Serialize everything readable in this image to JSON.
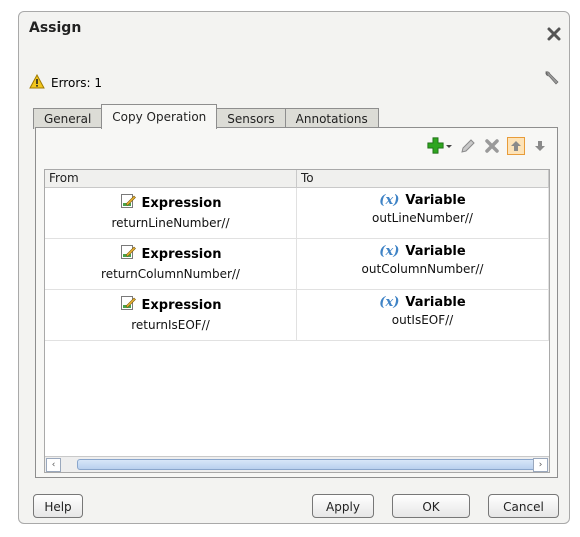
{
  "dialog": {
    "title": "Assign",
    "errors_label": "Errors: 1"
  },
  "tabs": [
    {
      "label": "General",
      "active": false
    },
    {
      "label": "Copy Operation",
      "active": true
    },
    {
      "label": "Sensors",
      "active": false
    },
    {
      "label": "Annotations",
      "active": false
    }
  ],
  "table": {
    "columns": [
      "From",
      "To"
    ],
    "rows": [
      {
        "from_kind": "Expression",
        "from_value": "returnLineNumber//",
        "to_kind": "Variable",
        "to_value": "outLineNumber//"
      },
      {
        "from_kind": "Expression",
        "from_value": "returnColumnNumber//",
        "to_kind": "Variable",
        "to_value": "outColumnNumber//"
      },
      {
        "from_kind": "Expression",
        "from_value": "returnIsEOF//",
        "to_kind": "Variable",
        "to_value": "outIsEOF//"
      }
    ],
    "variable_symbol": "(x)"
  },
  "buttons": {
    "help": "Help",
    "apply": "Apply",
    "ok": "OK",
    "cancel": "Cancel"
  },
  "colors": {
    "accent_green": "#2fa51f",
    "variable_blue": "#3f83c6",
    "warning_yellow": "#f2c61e"
  },
  "icons": {
    "toolbar": [
      "add-icon",
      "edit-icon",
      "delete-icon",
      "move-up-icon",
      "move-down-icon"
    ],
    "row_from": "expression-icon",
    "row_to": "variable-icon"
  }
}
